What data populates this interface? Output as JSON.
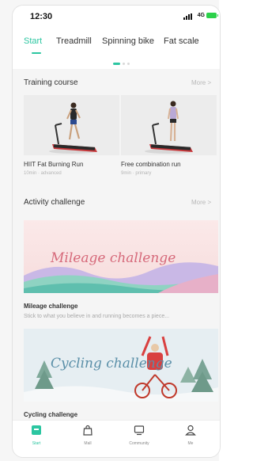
{
  "status_bar": {
    "time": "12:30",
    "network": "4G"
  },
  "tabs": [
    {
      "label": "Start",
      "active": true
    },
    {
      "label": "Treadmill",
      "active": false
    },
    {
      "label": "Spinning bike",
      "active": false
    },
    {
      "label": "Fat scale",
      "active": false
    }
  ],
  "carousel": {
    "pages": 3,
    "current": 1
  },
  "training": {
    "title": "Training course",
    "more": "More >",
    "courses": [
      {
        "title": "HIIT Fat Burning Run",
        "meta": "10min · advanced"
      },
      {
        "title": "Free combination run",
        "meta": "9min · primary"
      }
    ]
  },
  "activity": {
    "title": "Activity challenge",
    "more": "More >",
    "challenges": [
      {
        "banner_text": "Mileage challenge",
        "title": "Mileage challenge",
        "description": "Stick to what you believe in and running becomes a piece..."
      },
      {
        "banner_text": "Cycling challenge",
        "title": "Cycling challenge",
        "description": ""
      }
    ]
  },
  "bottom_nav": [
    {
      "label": "Start",
      "icon": "start-icon",
      "active": true
    },
    {
      "label": "Mall",
      "icon": "shopping-bag-icon",
      "active": false
    },
    {
      "label": "Community",
      "icon": "community-icon",
      "active": false
    },
    {
      "label": "Me",
      "icon": "person-icon",
      "active": false
    }
  ],
  "colors": {
    "accent": "#2cc6a1",
    "background": "#f5f5f5",
    "treadmill_red": "#c8383b"
  }
}
